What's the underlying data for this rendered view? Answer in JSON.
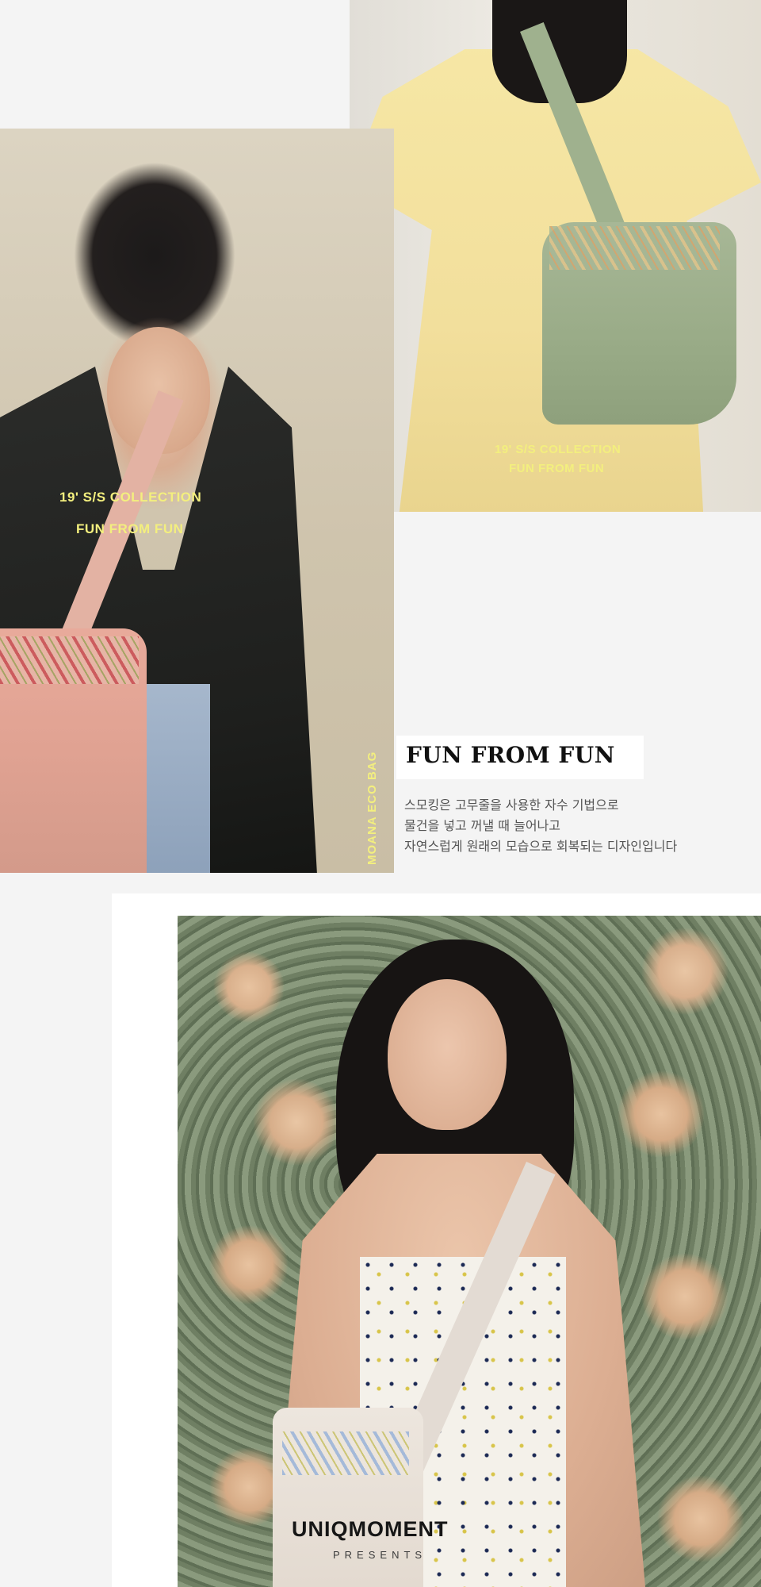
{
  "section1": {
    "left_photo": {
      "alt": "Model in black blazer carrying pink smocked eco bag",
      "overlay_line1": "19' S/S COLLECTION",
      "overlay_line2": "FUN FROM FUN"
    },
    "right_photo": {
      "alt": "Model in yellow dress carrying green smocked eco bag",
      "overlay_line1": "19' S/S COLLECTION",
      "overlay_line2": "FUN FROM FUN"
    },
    "vertical_label": "MOANA ECO BAG",
    "headline": "FUN FROM FUN",
    "description": [
      "스모킹은 고무줄을 사용한 자수 기법으로",
      "물건을 넣고 꺼낼 때 늘어나고",
      "자연스럽게 원래의 모습으로 회복되는 디자인입니다"
    ]
  },
  "section2": {
    "photo": {
      "alt": "Model in floral camisole dress with ivory smocked eco bag against botanical wallpaper"
    },
    "brand": "UNIQMOMENT",
    "brand_sub": "PRESENTS"
  },
  "colors": {
    "page_background": "#f4f4f4",
    "overlay_text": "#f3ef7e",
    "headline_text": "#111111",
    "description_text": "#555555"
  }
}
